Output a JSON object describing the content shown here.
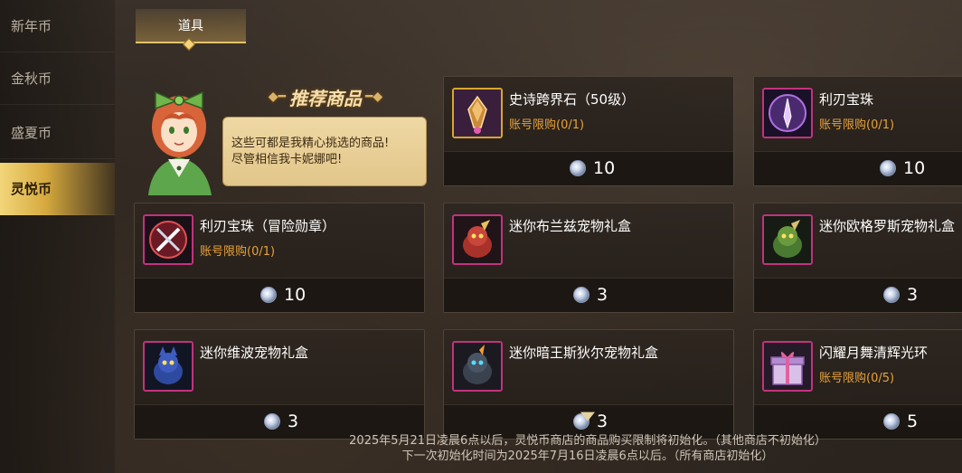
{
  "sidebar": {
    "items": [
      {
        "label": "新年币"
      },
      {
        "label": "金秋币"
      },
      {
        "label": "盛夏币"
      },
      {
        "label": "灵悦币"
      }
    ],
    "active_index": 3
  },
  "tab": {
    "label": "道具"
  },
  "recommended": {
    "title": "推荐商品",
    "bubble_line1": "这些可都是我精心挑选的商品!",
    "bubble_line2": "尽管相信我卡妮娜吧!"
  },
  "items": [
    {
      "name": "史诗跨界石（50级）",
      "limit": "账号限购(0/1)",
      "price": "10",
      "icon": "epic-crossover-stone-icon"
    },
    {
      "name": "利刃宝珠",
      "limit": "账号限购(0/1)",
      "price": "10",
      "icon": "blade-orb-icon"
    },
    {
      "name": "利刃宝珠（冒险勋章）",
      "limit": "账号限购(0/1)",
      "price": "10",
      "icon": "blade-orb-medal-icon"
    },
    {
      "name": "迷你布兰兹宠物礼盒",
      "limit": "",
      "price": "3",
      "icon": "pet-red-dragon-icon"
    },
    {
      "name": "迷你欧格罗斯宠物礼盒",
      "limit": "",
      "price": "3",
      "icon": "pet-green-dragon-icon"
    },
    {
      "name": "迷你维波宠物礼盒",
      "limit": "",
      "price": "3",
      "icon": "pet-blue-wolf-icon"
    },
    {
      "name": "迷你暗王斯狄尔宠物礼盒",
      "limit": "",
      "price": "3",
      "icon": "pet-dark-king-icon"
    },
    {
      "name": "闪耀月舞清辉光环",
      "limit": "账号限购(0/5)",
      "price": "5",
      "icon": "gift-box-icon"
    }
  ],
  "footer": {
    "line1": "2025年5月21日凌晨6点以后，灵悦币商店的商品购买限制将初始化。（其他商店不初始化）",
    "line2": "下一次初始化时间为2025年7月16日凌晨6点以后。（所有商店初始化）"
  },
  "colors": {
    "accent_gold": "#e2c36a",
    "limit_orange": "#e8a23a",
    "rarity_purple": "#c1337d"
  }
}
